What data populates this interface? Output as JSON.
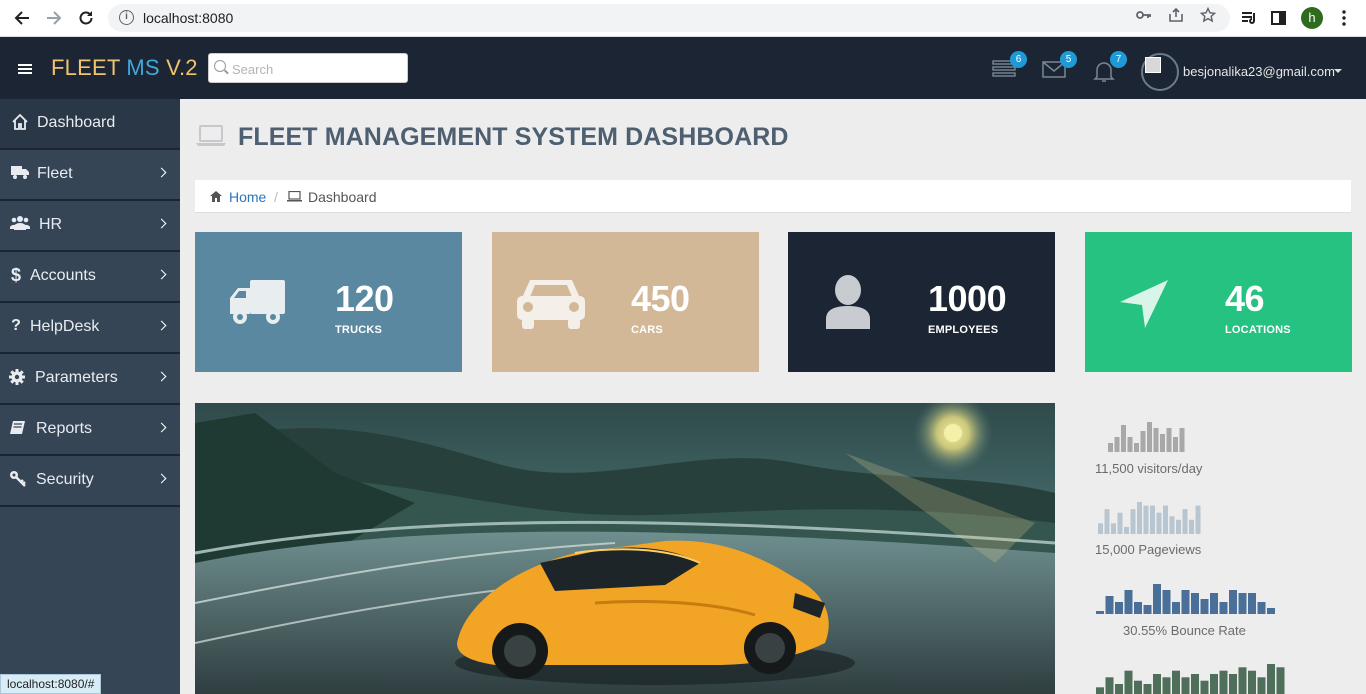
{
  "browser": {
    "url": "localhost:8080",
    "profile_initial": "h",
    "status_url": "localhost:8080/#"
  },
  "navbar": {
    "brand_part1": "FLEET",
    "brand_part2": "MS",
    "brand_part3": "V.2",
    "search_placeholder": "Search",
    "tasks_count": "6",
    "messages_count": "5",
    "notifications_count": "7",
    "user_email": "besjonalika23@gmail.com"
  },
  "sidebar": {
    "items": [
      {
        "label": "Dashboard",
        "icon": "home-icon"
      },
      {
        "label": "Fleet",
        "icon": "truck-icon"
      },
      {
        "label": "HR",
        "icon": "users-icon"
      },
      {
        "label": "Accounts",
        "icon": "dollar-icon"
      },
      {
        "label": "HelpDesk",
        "icon": "question-icon"
      },
      {
        "label": "Parameters",
        "icon": "gear-icon"
      },
      {
        "label": "Reports",
        "icon": "book-icon"
      },
      {
        "label": "Security",
        "icon": "key-icon"
      }
    ]
  },
  "page": {
    "title": "FLEET MANAGEMENT SYSTEM DASHBOARD",
    "breadcrumb_home": "Home",
    "breadcrumb_sep": "/",
    "breadcrumb_current": "Dashboard"
  },
  "stats": [
    {
      "value": "120",
      "label": "TRUCKS",
      "color": "#5a88a0"
    },
    {
      "value": "450",
      "label": "CARS",
      "color": "#d2b896"
    },
    {
      "value": "1000",
      "label": "EMPLOYEES",
      "color": "#1c2533"
    },
    {
      "value": "46",
      "label": "LOCATIONS",
      "color": "#26c281"
    }
  ],
  "sparklines": [
    {
      "label": "11,500 visitors/day",
      "color": "#a8a8a8",
      "values": [
        3,
        5,
        9,
        5,
        3,
        7,
        10,
        8,
        6,
        8,
        5,
        8
      ]
    },
    {
      "label": "15,000 Pageviews",
      "color": "#b8c6d2",
      "values": [
        3,
        7,
        3,
        6,
        2,
        7,
        9,
        8,
        8,
        6,
        8,
        5,
        4,
        7,
        4,
        8
      ]
    },
    {
      "label": "30.55% Bounce Rate",
      "color": "#4a6f98",
      "values": [
        1,
        6,
        4,
        8,
        4,
        3,
        10,
        8,
        4,
        8,
        7,
        5,
        7,
        4,
        8,
        7,
        7,
        4,
        2
      ]
    },
    {
      "label": "",
      "color": "#4f6f5a",
      "values": [
        2,
        5,
        3,
        7,
        4,
        3,
        6,
        5,
        7,
        5,
        6,
        4,
        6,
        7,
        6,
        8,
        7,
        5,
        9,
        8
      ]
    }
  ]
}
